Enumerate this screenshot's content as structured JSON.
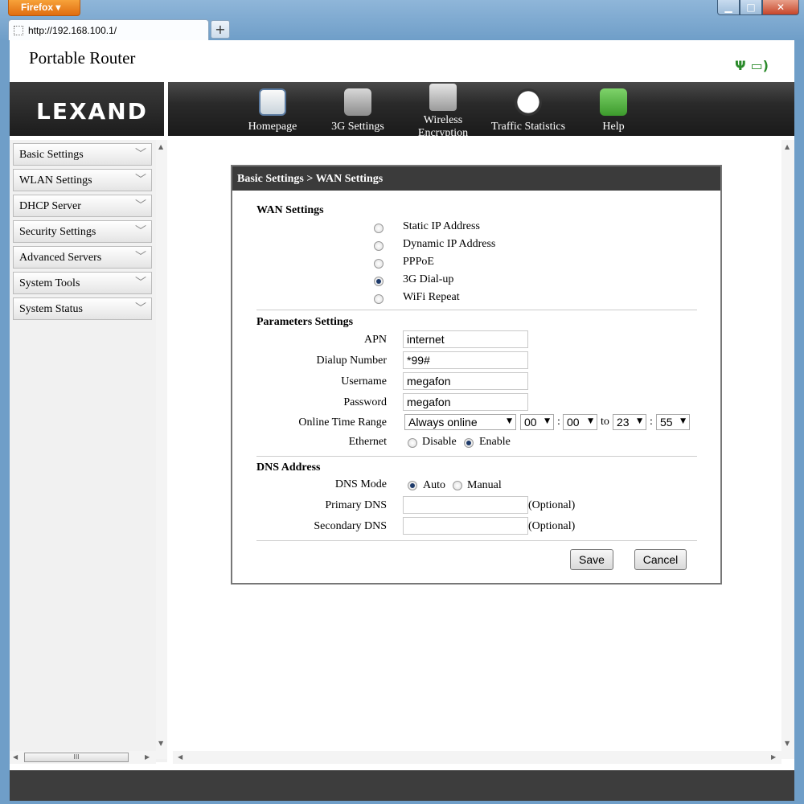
{
  "browser": {
    "menu_button": "Firefox",
    "tab_title": "http://192.168.100.1/",
    "new_tab": "+",
    "min": "▁",
    "max": "□",
    "close": "✕"
  },
  "header": {
    "title": "Portable Router",
    "logo": "LEXAND"
  },
  "nav": {
    "items": [
      {
        "label": "Homepage",
        "icon": "home-icon"
      },
      {
        "label": "3G Settings",
        "icon": "tools-icon"
      },
      {
        "label": "Wireless Encryption",
        "icon": "lock-icon"
      },
      {
        "label": "Traffic Statistics",
        "icon": "clock-icon"
      },
      {
        "label": "Help",
        "icon": "book-icon"
      }
    ]
  },
  "sidebar": {
    "items": [
      {
        "label": "Basic Settings"
      },
      {
        "label": "WLAN Settings"
      },
      {
        "label": "DHCP Server"
      },
      {
        "label": "Security Settings"
      },
      {
        "label": "Advanced Servers"
      },
      {
        "label": "System Tools"
      },
      {
        "label": "System Status"
      }
    ],
    "scroll_thumb": "III"
  },
  "panel": {
    "breadcrumb": "Basic Settings > WAN Settings",
    "wan": {
      "title": "WAN Settings",
      "options": [
        {
          "label": "Static IP Address",
          "selected": false
        },
        {
          "label": "Dynamic IP Address",
          "selected": false
        },
        {
          "label": "PPPoE",
          "selected": false
        },
        {
          "label": "3G Dial-up",
          "selected": true
        },
        {
          "label": "WiFi Repeat",
          "selected": false
        }
      ]
    },
    "params": {
      "title": "Parameters Settings",
      "apn_label": "APN",
      "apn_value": "internet",
      "dialup_label": "Dialup Number",
      "dialup_value": "*99#",
      "username_label": "Username",
      "username_value": "megafon",
      "password_label": "Password",
      "password_value": "megafon",
      "time_label": "Online Time Range",
      "time_mode": "Always online",
      "start_hour": "00",
      "start_min": "00",
      "to": "to",
      "end_hour": "23",
      "end_min": "55",
      "colon": ":",
      "ethernet_label": "Ethernet",
      "ethernet_disable": "Disable",
      "ethernet_enable": "Enable",
      "ethernet_selected": "Enable"
    },
    "dns": {
      "title": "DNS Address",
      "mode_label": "DNS Mode",
      "mode_auto": "Auto",
      "mode_manual": "Manual",
      "mode_selected": "Auto",
      "primary_label": "Primary DNS",
      "primary_value": "",
      "secondary_label": "Secondary DNS",
      "secondary_value": "",
      "optional": "(Optional)"
    },
    "buttons": {
      "save": "Save",
      "cancel": "Cancel"
    }
  }
}
